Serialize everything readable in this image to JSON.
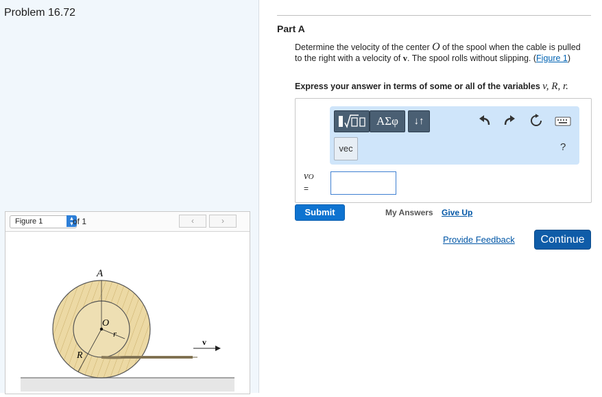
{
  "problem": {
    "title": "Problem 16.72"
  },
  "figure_panel": {
    "selector_label": "Figure 1",
    "of_text": "of 1",
    "prev_icon": "chevron-left-icon",
    "next_icon": "chevron-right-icon",
    "labels": {
      "A": "A",
      "O": "O",
      "r": "r",
      "R": "R",
      "v": "v"
    }
  },
  "part": {
    "title": "Part A",
    "question_pre": "Determine the velocity of the center ",
    "question_O": "O",
    "question_mid": " of the spool when the cable is pulled to the right with a velocity of ",
    "question_v": "v",
    "question_post": ". The spool rolls without slipping. (",
    "figure_link": "Figure 1",
    "question_close": ")",
    "instruction": "Express your answer in terms of some or all of the variables ",
    "variables": "v, R, r."
  },
  "toolbar": {
    "template_icon": "template-icon",
    "greek_label": "ΑΣφ",
    "arrows_label": "↓↑",
    "vec_label": "vec",
    "undo_icon": "undo-icon",
    "redo_icon": "redo-icon",
    "reset_icon": "reset-icon",
    "keyboard_icon": "keyboard-icon",
    "help_label": "?"
  },
  "answer": {
    "variable": "v",
    "variable_sub": "O",
    "equals": "=",
    "value": ""
  },
  "actions": {
    "submit": "Submit",
    "my_answers": "My Answers",
    "give_up": "Give Up",
    "feedback": "Provide Feedback",
    "continue": "Continue"
  }
}
